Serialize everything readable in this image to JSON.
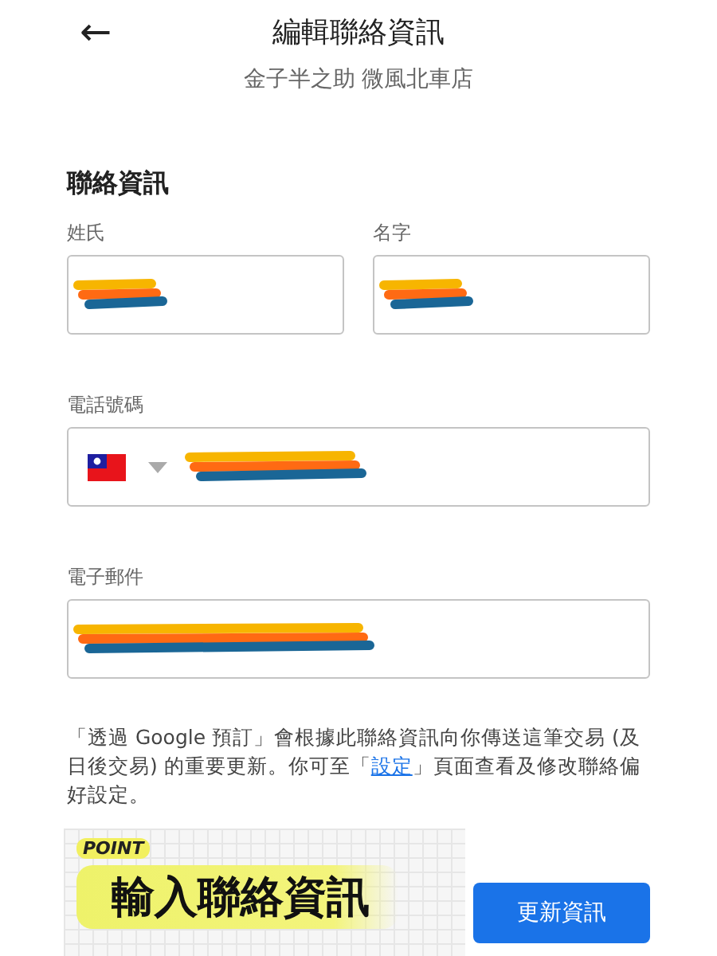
{
  "header": {
    "back_icon": "←",
    "title": "編輯聯絡資訊",
    "subtitle": "金子半之助 微風北車店"
  },
  "section": {
    "title": "聯絡資訊"
  },
  "name_fields": [
    {
      "label": "姓氏",
      "redacted": true
    },
    {
      "label": "名字",
      "redacted": true
    }
  ],
  "phone_field": {
    "label": "電話號碼",
    "redacted": true
  },
  "email_field": {
    "label": "電子郵件",
    "redacted": true
  },
  "notice": {
    "before": "「透過 Google 預訂」會根據此聯絡資訊向你傳送這筆交易 (及日後交易) 的重要更新。你可至「",
    "link": "設定",
    "after": "」頁面查看及修改聯絡偏好設定。"
  },
  "sticker": {
    "tag": "POINT",
    "text": "輸入聯絡資訊"
  },
  "buttons": [
    {
      "label": "更新資訊",
      "kind": "primary"
    }
  ]
}
